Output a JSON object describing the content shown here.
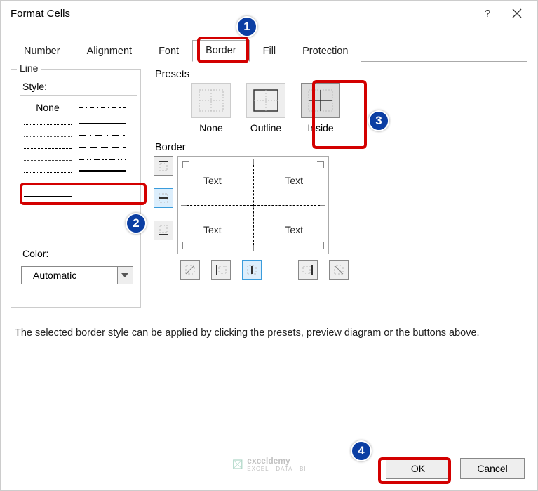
{
  "title": "Format Cells",
  "help_glyph": "?",
  "tabs": [
    "Number",
    "Alignment",
    "Font",
    "Border",
    "Fill",
    "Protection"
  ],
  "active_tab": "Border",
  "line": {
    "legend": "Line",
    "style_label": "Style:",
    "none_label": "None",
    "color_label": "Color:",
    "color_value": "Automatic"
  },
  "presets": {
    "legend": "Presets",
    "items": [
      {
        "label": "None",
        "accel": "N"
      },
      {
        "label": "Outline",
        "accel": "O"
      },
      {
        "label": "Inside",
        "accel": "I"
      }
    ]
  },
  "border": {
    "legend": "Border",
    "preview_text": "Text"
  },
  "hint": "The selected border style can be applied by clicking the presets, preview diagram or the buttons above.",
  "buttons": {
    "ok": "OK",
    "cancel": "Cancel"
  },
  "callouts": [
    "1",
    "2",
    "3",
    "4"
  ],
  "watermark": {
    "name": "exceldemy",
    "tag": "EXCEL · DATA · BI"
  }
}
